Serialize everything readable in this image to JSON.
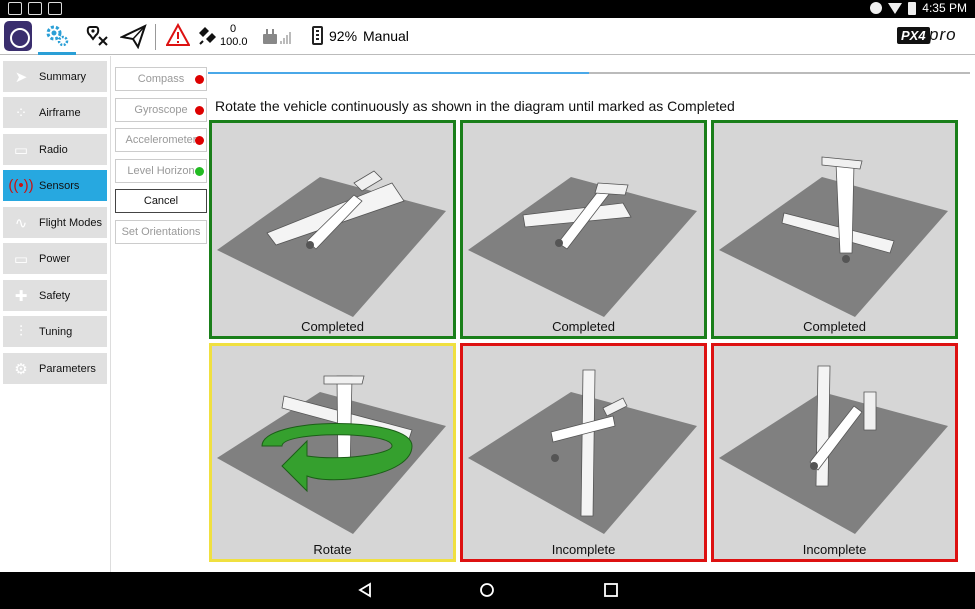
{
  "toolbar": {
    "gps_count": "0",
    "gps_hdop": "100.0",
    "battery": "92%",
    "flight_mode": "Manual",
    "brand_badge": "PX4",
    "brand_suffix": "pro"
  },
  "status_bar": {
    "time": "4:35 PM"
  },
  "nav": [
    {
      "label": "Summary",
      "icon": "paper-plane-icon"
    },
    {
      "label": "Airframe",
      "icon": "airframe-icon"
    },
    {
      "label": "Radio",
      "icon": "radio-transmitter-icon"
    },
    {
      "label": "Sensors",
      "icon": "sensors-icon",
      "active": true
    },
    {
      "label": "Flight Modes",
      "icon": "flight-modes-icon"
    },
    {
      "label": "Power",
      "icon": "battery-icon"
    },
    {
      "label": "Safety",
      "icon": "first-aid-icon"
    },
    {
      "label": "Tuning",
      "icon": "sliders-icon"
    },
    {
      "label": "Parameters",
      "icon": "gears-icon"
    }
  ],
  "sensors": [
    {
      "label": "Compass",
      "status_color": "#dd0000"
    },
    {
      "label": "Gyroscope",
      "status_color": "#dd0000"
    },
    {
      "label": "Accelerometer",
      "status_color": "#dd0000"
    },
    {
      "label": "Level Horizon",
      "status_color": "#22bb22"
    }
  ],
  "actions": {
    "cancel": "Cancel",
    "set_orientations": "Set Orientations"
  },
  "calibration": {
    "progress": 0.5,
    "instructions": "Rotate the vehicle continuously as shown in the diagram until marked as Completed",
    "tiles": [
      {
        "label": "Completed",
        "color": "#1a7f1a"
      },
      {
        "label": "Completed",
        "color": "#1a7f1a"
      },
      {
        "label": "Completed",
        "color": "#1a7f1a"
      },
      {
        "label": "Rotate",
        "color": "#f0e040"
      },
      {
        "label": "Incomplete",
        "color": "#dd1111"
      },
      {
        "label": "Incomplete",
        "color": "#dd1111"
      }
    ]
  }
}
